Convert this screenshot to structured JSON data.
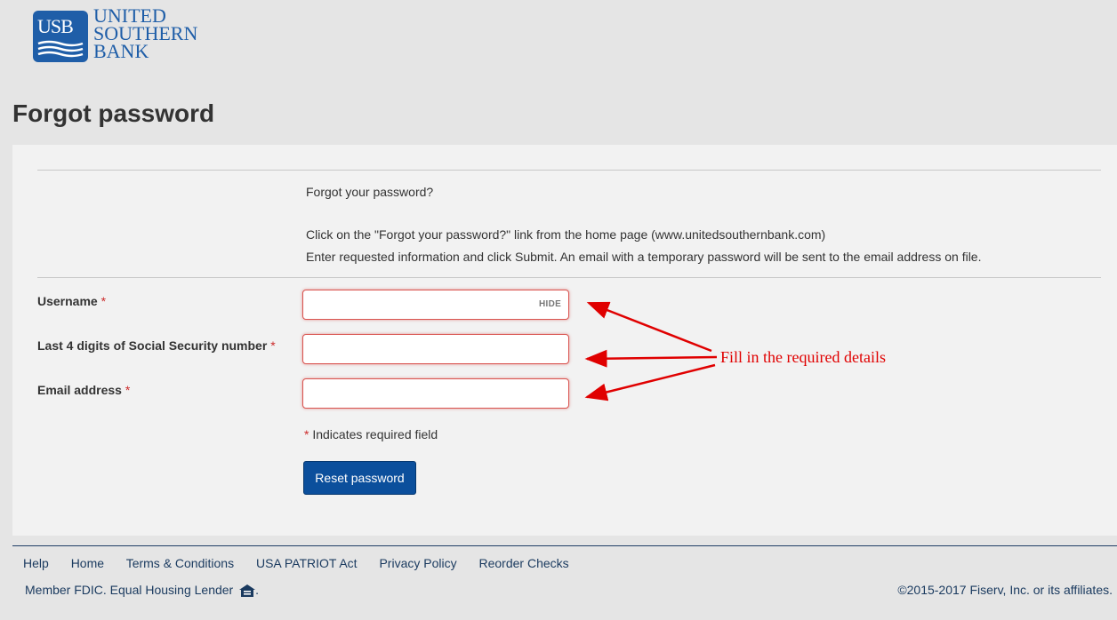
{
  "logo": {
    "mark": "USB",
    "lines": [
      "UNITED",
      "SOUTHERN",
      "BANK"
    ]
  },
  "page_title": "Forgot password",
  "instructions": {
    "question": "Forgot your password?",
    "line1": "Click on the \"Forgot your password?\" link from the home page (www.unitedsouthernbank.com)",
    "line2": "Enter requested information and click Submit. An email with a temporary password will be sent to the email address on file."
  },
  "form": {
    "username_label": "Username",
    "ssn_label": "Last 4 digits of Social Security number",
    "email_label": "Email address",
    "required_mark": "*",
    "hide_label": "HIDE",
    "username_value": "",
    "ssn_value": "",
    "email_value": "",
    "required_note": "Indicates required field",
    "reset_button": "Reset password"
  },
  "annotation": "Fill in the required details",
  "colors": {
    "brand": "#1f5ea8",
    "button": "#0b4f9c",
    "error_border": "#d9534f",
    "annotation": "#e00000"
  },
  "footer": {
    "links": [
      "Help",
      "Home",
      "Terms & Conditions",
      "USA PATRIOT Act",
      "Privacy Policy",
      "Reorder Checks"
    ],
    "fdic": "Member FDIC. Equal Housing Lender",
    "copyright": "©2015-2017 Fiserv, Inc. or its affiliates."
  }
}
